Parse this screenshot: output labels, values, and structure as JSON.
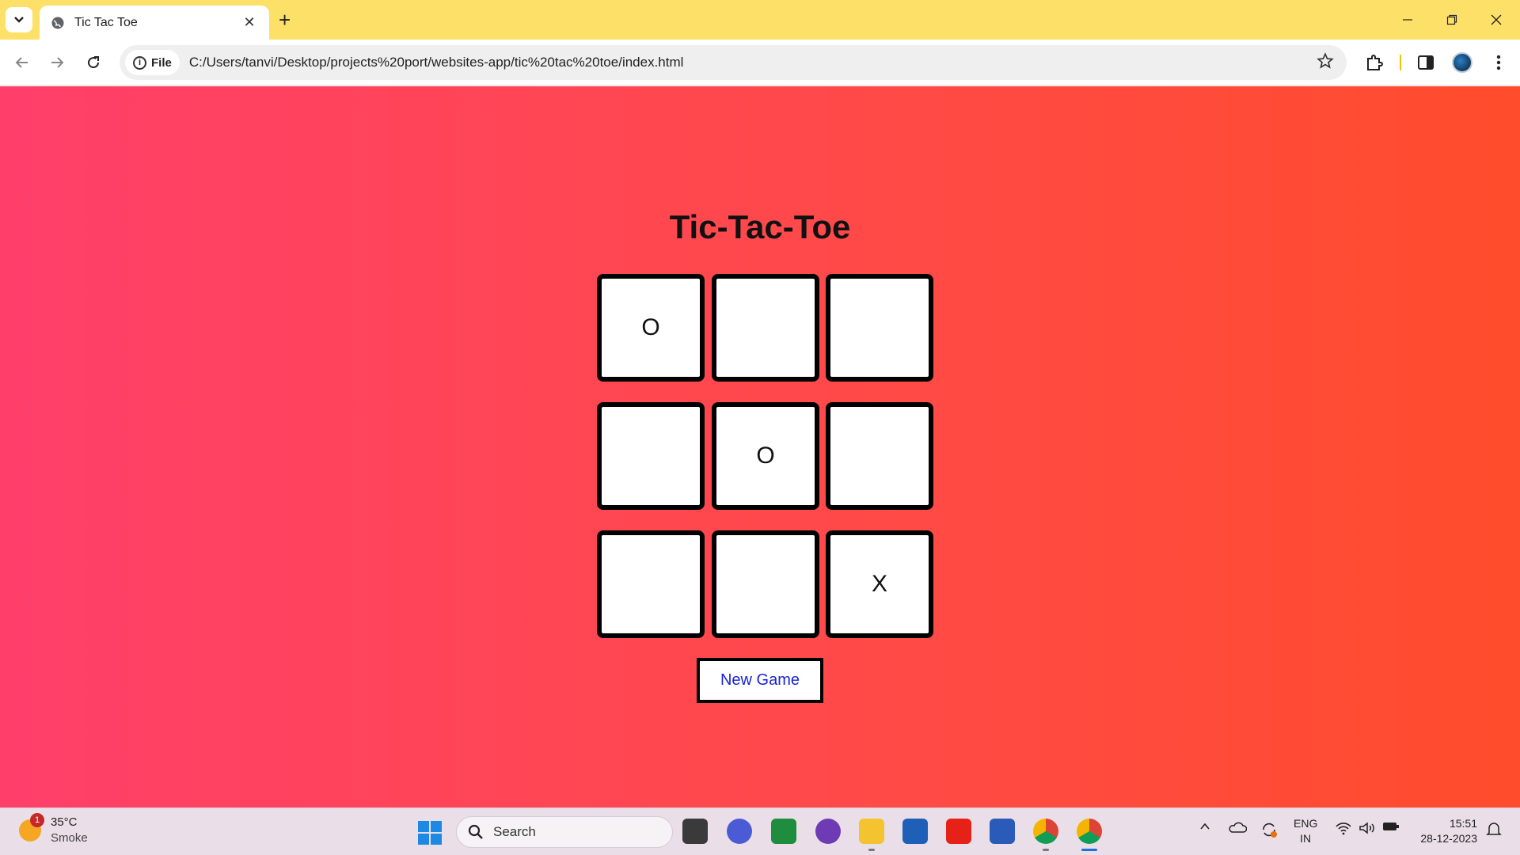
{
  "browser": {
    "tab_title": "Tic Tac Toe",
    "new_tab_symbol": "+",
    "site_info_label": "File",
    "url": "C:/Users/tanvi/Desktop/projects%20port/websites-app/tic%20tac%20toe/index.html"
  },
  "game": {
    "title": "Tic-Tac-Toe",
    "cells": [
      "O",
      "",
      "",
      "",
      "O",
      "",
      "",
      "",
      "X"
    ],
    "new_game_label": "New Game"
  },
  "taskbar": {
    "weather_temp": "35°C",
    "weather_desc": "Smoke",
    "weather_badge": "1",
    "search_placeholder": "Search",
    "lang_line1": "ENG",
    "lang_line2": "IN",
    "time": "15:51",
    "date": "28-12-2023"
  },
  "colors": {
    "tabstrip": "#fde068",
    "page_gradient_start": "#ff3f6a",
    "page_gradient_end": "#ff4c2c",
    "new_game_text": "#1a23d9"
  }
}
